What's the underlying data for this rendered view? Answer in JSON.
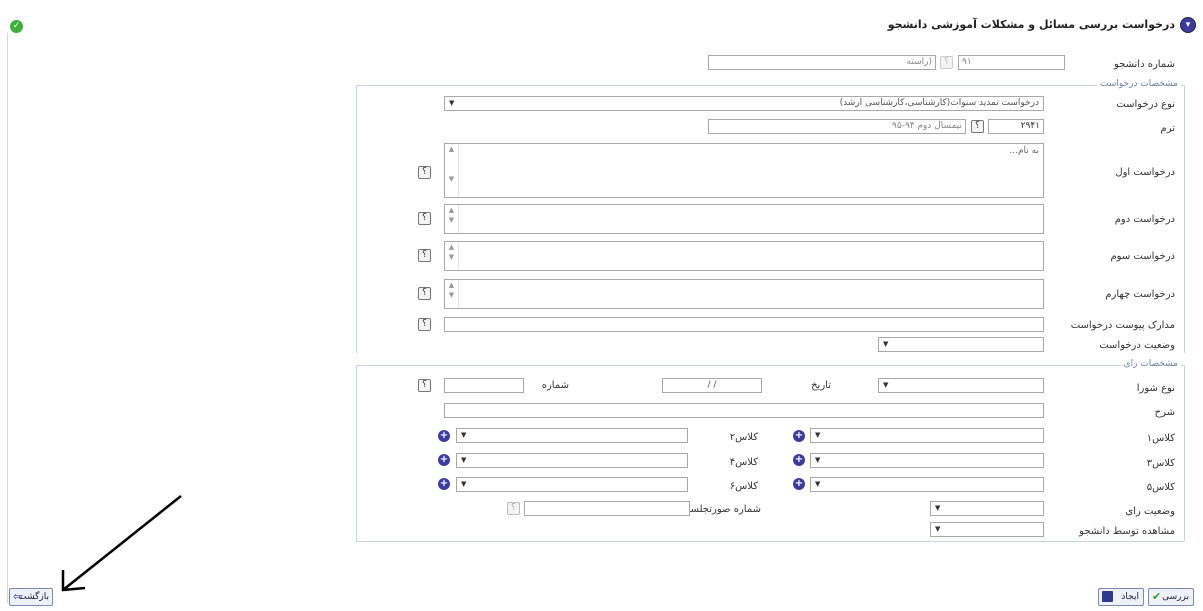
{
  "header": {
    "title": "درخواست بررسی مسائل و مشکلات آموزشی دانشجو"
  },
  "student": {
    "label": "شماره دانشجو",
    "number_value": "۹۱",
    "name_value": "(راسته"
  },
  "request_section": {
    "legend": "مشخصات درخواست",
    "type_label": "نوع درخواست",
    "type_value": "درخواست تمدید سنوات(کارشناسی،کارشناسی ارشد)",
    "term_label": "ترم",
    "term_value": "۲۹۴۱",
    "term_desc": "نیمسال دوم ۹۴-۹۵",
    "first_label": "درخواست اول",
    "first_value": "به نام...",
    "second_label": "درخواست دوم",
    "third_label": "درخواست سوم",
    "fourth_label": "درخواست چهارم",
    "attachments_label": "مدارک پیوست درخواست",
    "status_label": "وضعیت درخواست"
  },
  "decision_section": {
    "legend": "مشخصات رای",
    "council_type_label": "نوع شورا",
    "date_label": "تاریخ",
    "date_value": "/ /",
    "number_label": "شماره",
    "description_label": "شرح",
    "class1_label": "کلاس۱",
    "class2_label": "کلاس۲",
    "class3_label": "کلاس۳",
    "class4_label": "کلاس۴",
    "class5_label": "کلاس۵",
    "class6_label": "کلاس۶",
    "vote_status_label": "وضعیت رای",
    "vote_number_label": "شماره صورتجلسه",
    "viewed_label": "مشاهده توسط دانشجو"
  },
  "buttons": {
    "confirm": "بررسی",
    "create": "ایجاد",
    "back": "بازگشت"
  },
  "colors": {
    "accent": "#3c3d9a",
    "legend": "#6c7fa8",
    "ok_icon": "#3fae3a"
  },
  "icons": {
    "ok": "check-circle-icon",
    "help": "question-icon",
    "add": "plus-circle-icon",
    "save": "floppy-icon",
    "back": "back-arrow-icon"
  }
}
